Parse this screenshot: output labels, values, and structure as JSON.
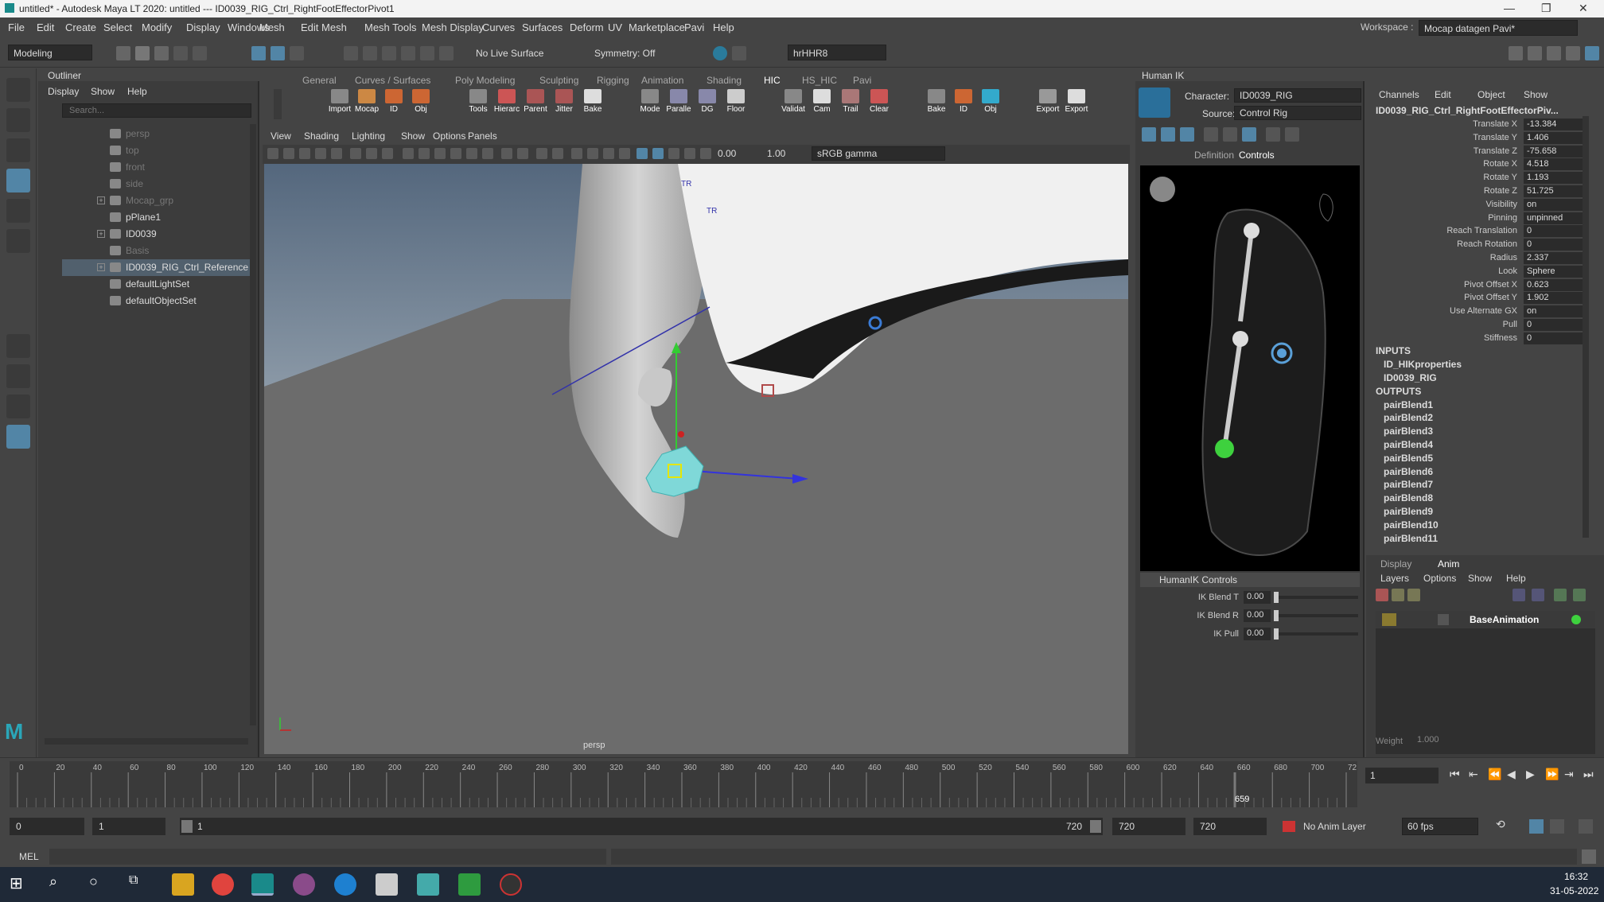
{
  "titlebar": {
    "title": "untitled* - Autodesk Maya LT 2020: untitled   ---  ID0039_RIG_Ctrl_RightFootEffectorPivot1"
  },
  "menubar": {
    "items": [
      "File",
      "Edit",
      "Create",
      "Select",
      "Modify",
      "Display",
      "Windows",
      "Mesh",
      "Edit Mesh",
      "Mesh Tools",
      "Mesh Display",
      "Curves",
      "Surfaces",
      "Deform",
      "UV",
      "Marketplace",
      "Pavi",
      "Help"
    ],
    "workspace_label": "Workspace :",
    "workspace_value": "Mocap datagen Pavi*"
  },
  "statusline": {
    "mode": "Modeling",
    "live_surface": "No Live Surface",
    "symmetry": "Symmetry: Off",
    "user": "hrHHR8"
  },
  "outliner": {
    "title": "Outliner",
    "menu": [
      "Display",
      "Show",
      "Help"
    ],
    "search_placeholder": "Search...",
    "rows": [
      {
        "label": "persp",
        "dim": true
      },
      {
        "label": "top",
        "dim": true
      },
      {
        "label": "front",
        "dim": true
      },
      {
        "label": "side",
        "dim": true
      },
      {
        "label": "Mocap_grp",
        "dim": true,
        "expander": true
      },
      {
        "label": "pPlane1"
      },
      {
        "label": "ID0039",
        "expander": true
      },
      {
        "label": "Basis",
        "dim": true
      },
      {
        "label": "ID0039_RIG_Ctrl_Reference",
        "selected": true,
        "expander": true
      },
      {
        "label": "defaultLightSet"
      },
      {
        "label": "defaultObjectSet"
      }
    ]
  },
  "shelf": {
    "tabs": [
      "General",
      "Curves / Surfaces",
      "Poly Modeling",
      "Sculpting",
      "Rigging",
      "Animation",
      "Shading",
      "HIC",
      "HS_HIC",
      "Pavi"
    ],
    "active_tab": "HIC",
    "buttons": [
      "Import",
      "Mocap",
      "ID",
      "Obj",
      "Tools",
      "Hierarc",
      "Parent",
      "Jitter",
      "Bake",
      "Mode",
      "Paralle",
      "DG",
      "Floor",
      "Validat",
      "Cam",
      "Trail",
      "Clear",
      "Bake",
      "ID",
      "Obj",
      "Export",
      "Export"
    ]
  },
  "viewport": {
    "menu": [
      "View",
      "Shading",
      "Lighting",
      "Show",
      "Options",
      "Panels"
    ],
    "field1": "0.00",
    "field2": "1.00",
    "colorspace": "sRGB gamma",
    "camera_label": "persp",
    "tr_label1": "TR",
    "tr_label2": "TR"
  },
  "hik": {
    "title": "Human IK",
    "character_label": "Character:",
    "character_value": "ID0039_RIG",
    "source_label": "Source:",
    "source_value": "Control Rig",
    "tabs": [
      "Definition",
      "Controls"
    ],
    "active_tab": "Controls",
    "controls_header": "HumanIK Controls",
    "sliders": [
      {
        "label": "IK Blend T",
        "value": "0.00"
      },
      {
        "label": "IK Blend R",
        "value": "0.00"
      },
      {
        "label": "IK Pull",
        "value": "0.00"
      }
    ]
  },
  "channels": {
    "menu": [
      "Channels",
      "Edit",
      "Object",
      "Show"
    ],
    "node": "ID0039_RIG_Ctrl_RightFootEffectorPiv...",
    "attrs": [
      {
        "k": "Translate X",
        "v": "-13.384"
      },
      {
        "k": "Translate Y",
        "v": "1.406"
      },
      {
        "k": "Translate Z",
        "v": "-75.658"
      },
      {
        "k": "Rotate X",
        "v": "4.518"
      },
      {
        "k": "Rotate Y",
        "v": "1.193"
      },
      {
        "k": "Rotate Z",
        "v": "51.725"
      },
      {
        "k": "Visibility",
        "v": "on"
      },
      {
        "k": "Pinning",
        "v": "unpinned"
      },
      {
        "k": "Reach Translation",
        "v": "0"
      },
      {
        "k": "Reach Rotation",
        "v": "0"
      },
      {
        "k": "Radius",
        "v": "2.337"
      },
      {
        "k": "Look",
        "v": "Sphere"
      },
      {
        "k": "Pivot Offset X",
        "v": "0.623"
      },
      {
        "k": "Pivot Offset Y",
        "v": "1.902"
      },
      {
        "k": "Use Alternate GX",
        "v": "on"
      },
      {
        "k": "Pull",
        "v": "0"
      },
      {
        "k": "Stiffness",
        "v": "0"
      }
    ],
    "inputs_label": "INPUTS",
    "inputs": [
      "ID_HIKproperties",
      "ID0039_RIG"
    ],
    "outputs_label": "OUTPUTS",
    "outputs": [
      "pairBlend1",
      "pairBlend2",
      "pairBlend3",
      "pairBlend4",
      "pairBlend5",
      "pairBlend6",
      "pairBlend7",
      "pairBlend8",
      "pairBlend9",
      "pairBlend10",
      "pairBlend11"
    ],
    "layer_tabs": [
      "Display",
      "Anim"
    ],
    "layer_menu": [
      "Layers",
      "Options",
      "Show",
      "Help"
    ],
    "layer_name": "BaseAnimation",
    "weight_label": "Weight",
    "weight_value": "1.000"
  },
  "timeline": {
    "ticks": [
      "0",
      "20",
      "40",
      "60",
      "80",
      "100",
      "120",
      "140",
      "160",
      "180",
      "200",
      "220",
      "240",
      "260",
      "280",
      "300",
      "320",
      "340",
      "360",
      "380",
      "400",
      "420",
      "440",
      "460",
      "480",
      "500",
      "520",
      "540",
      "560",
      "580",
      "600",
      "620",
      "640",
      "660",
      "680",
      "700",
      "72"
    ],
    "current_frame": "659",
    "frame_field": "1",
    "range_start": "0",
    "range_start2": "1",
    "range_slider_start": "1",
    "range_slider_end": "720",
    "range_end": "720",
    "range_end2": "720",
    "anim_layer": "No Anim Layer",
    "fps": "60 fps"
  },
  "cmdline": {
    "label": "MEL"
  },
  "taskbar": {
    "time": "16:32",
    "date": "31-05-2022"
  },
  "colors": {
    "accent": "#5285a6",
    "bg": "#444444",
    "panel": "#3c3c3c",
    "field": "#2b2b2b"
  }
}
